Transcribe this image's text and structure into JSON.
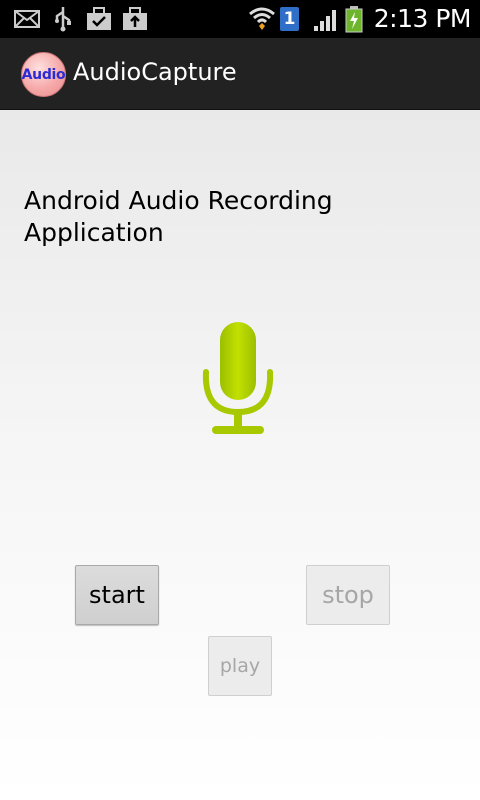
{
  "status_bar": {
    "time": "2:13 PM",
    "sim_slot": "1",
    "icons": [
      "mail-icon",
      "usb-icon",
      "briefcase-check-icon",
      "briefcase-upload-icon",
      "wifi-icon",
      "sim-icon",
      "signal-icon",
      "battery-charging-icon"
    ]
  },
  "action_bar": {
    "app_icon_text": "Audio",
    "title": "AudioCapture"
  },
  "main": {
    "heading": "Android Audio Recording Application",
    "mic_icon": "microphone-icon",
    "mic_color": "#a8c800",
    "buttons": {
      "start": "start",
      "stop": "stop",
      "play": "play"
    }
  }
}
